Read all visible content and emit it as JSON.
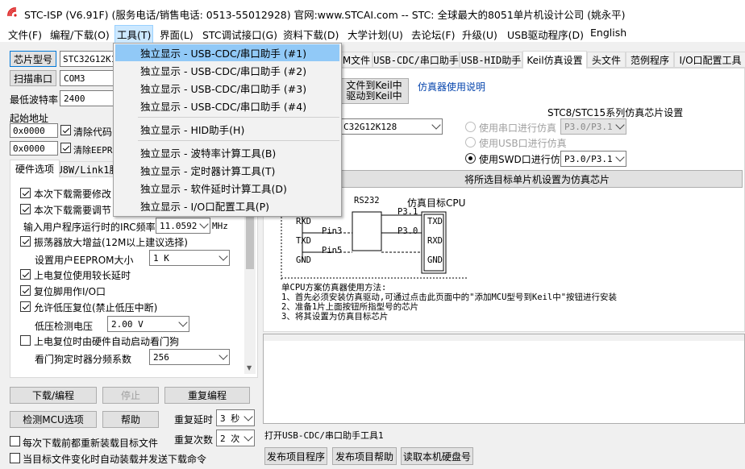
{
  "window": {
    "title": "STC-ISP (V6.91F) (服务电话/销售电话: 0513-55012928) 官网:www.STCAI.com  -- STC: 全球最大的8051单片机设计公司 (姚永平)"
  },
  "menubar": {
    "items": [
      "文件(F)",
      "编程/下载(O)",
      "工具(T)",
      "界面(L)",
      "STC调试接口(G)",
      "资料下载(D)",
      "大学计划(U)",
      "去论坛(F)",
      "升级(U)",
      "USB驱动程序(D)",
      "English"
    ]
  },
  "tools_menu": {
    "items": [
      "独立显示 - USB-CDC/串口助手 (#1)",
      "独立显示 - USB-CDC/串口助手 (#2)",
      "独立显示 - USB-CDC/串口助手 (#3)",
      "独立显示 - USB-CDC/串口助手 (#4)",
      "独立显示 - HID助手(H)",
      "独立显示 - 波特率计算工具(B)",
      "独立显示 - 定时器计算工具(T)",
      "独立显示 - 软件延时计算工具(D)",
      "独立显示 - I/O口配置工具(P)"
    ]
  },
  "left": {
    "chip_button": "芯片型号",
    "chip_value": "STC32G12K1",
    "scan_button": "扫描串口",
    "com_value": "COM3",
    "baud_label": "最低波特率",
    "baud_value": "2400",
    "start_addr_label": "起始地址",
    "addr1": "0x0000",
    "clear_code": "清除代码",
    "addr2": "0x0000",
    "clear_eeprom": "清除EEPR",
    "tabs": [
      "硬件选项",
      "U8W/Link1脱"
    ],
    "options": {
      "opt1": "本次下载需要修改",
      "opt2": "本次下载需要调节",
      "irc_label": "输入用户程序运行时的IRC频率",
      "irc_value": "11.0592",
      "irc_unit": "MHz",
      "osc": "振荡器放大增益(12M以上建议选择)",
      "eeprom_label": "设置用户EEPROM大小",
      "eeprom_value": "1    K",
      "poweron": "上电复位使用较长延时",
      "reset_io": "复位脚用作I/O口",
      "lvr": "允许低压复位(禁止低压中断)",
      "lv_label": "低压检测电压",
      "lv_value": "2.00 V",
      "wdt_auto": "上电复位时由硬件自动启动看门狗",
      "wdt_label": "看门狗定时器分频系数",
      "wdt_value": "256"
    },
    "download_btn": "下载/编程",
    "stop_btn": "停止",
    "reprogram_btn": "重复编程",
    "detect_btn": "检测MCU选项",
    "help_btn": "帮助",
    "repeat_delay_label": "重复延时",
    "repeat_delay_value": "3 秒",
    "repeat_count_label": "重复次数",
    "repeat_count_value": "2 次",
    "reload_each": "每次下载前都重新装载目标文件",
    "auto_send": "当目标文件变化时自动装载并发送下载命令"
  },
  "right": {
    "tabs": [
      "M文件",
      "USB-CDC/串口助手",
      "USB-HID助手",
      "Keil仿真设置",
      "头文件",
      "范例程序",
      "I/O口配置工具"
    ],
    "add_keil_line1": "文件到Keil中",
    "add_keil_line2": "驱动到Keil中",
    "emu_help_link": "仿真器使用说明",
    "chip_combo": "C32G12K128",
    "series_label": "STC8/STC15系列仿真芯片设置",
    "radio1": "使用串口进行仿真",
    "radio1_value": "P3.0/P3.1",
    "radio2": "使用USB口进行仿真",
    "radio3": "使用SWD口进行仿真",
    "radio3_value": "P3.0/P3.1",
    "set_target_btn": "将所选目标单片机设置为仿真芯片",
    "diagram": {
      "rs232": "RS232",
      "target": "仿真目标CPU",
      "p31": "P3.1",
      "p30": "P3.0",
      "rxd_left": "RXD",
      "txd_left": "TXD",
      "gnd_left": "GND",
      "pin3": "Pin3",
      "pin5": "Pin5",
      "txd_right": "TXD",
      "rxd_right": "RXD",
      "gnd_right": "GND"
    },
    "instructions": [
      "单CPU方案仿真器使用方法:",
      "1、首先必须安装仿真驱动,可通过点击此页面中的\"添加MCU型号到Keil中\"按钮进行安装",
      "2、准备1片上面按钮所指型号的芯片",
      "3、将其设置为仿真目标芯片"
    ],
    "status_text": "打开USB-CDC/串口助手工具1",
    "publish_btn": "发布项目程序",
    "publish_help_btn": "发布项目帮助",
    "read_disk_btn": "读取本机硬盘号"
  },
  "colors": {
    "menu_highlight": "#91c9f7",
    "link": "#0645ad",
    "focus_border": "#0078d7"
  }
}
